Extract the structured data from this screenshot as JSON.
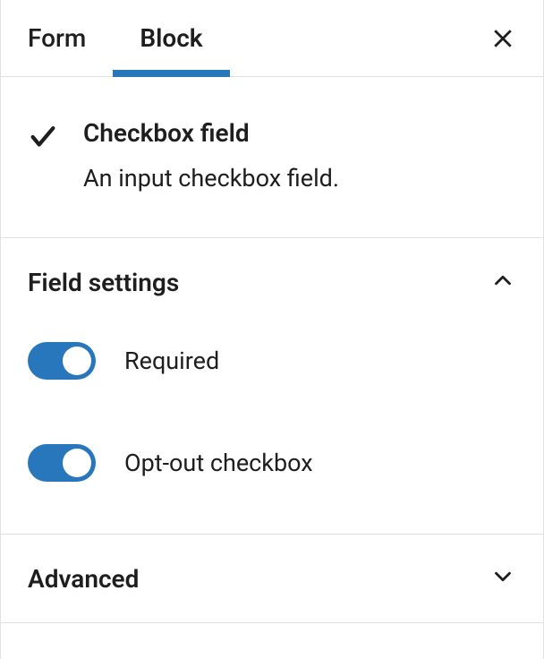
{
  "tabs": {
    "form": "Form",
    "block": "Block",
    "active": "block"
  },
  "block": {
    "title": "Checkbox field",
    "description": "An input checkbox field."
  },
  "sections": {
    "fieldSettings": {
      "title": "Field settings",
      "expanded": true,
      "toggles": {
        "required": {
          "label": "Required",
          "on": true
        },
        "optout": {
          "label": "Opt-out checkbox",
          "on": true
        }
      }
    },
    "advanced": {
      "title": "Advanced",
      "expanded": false
    }
  },
  "colors": {
    "accent": "#2877bd"
  }
}
